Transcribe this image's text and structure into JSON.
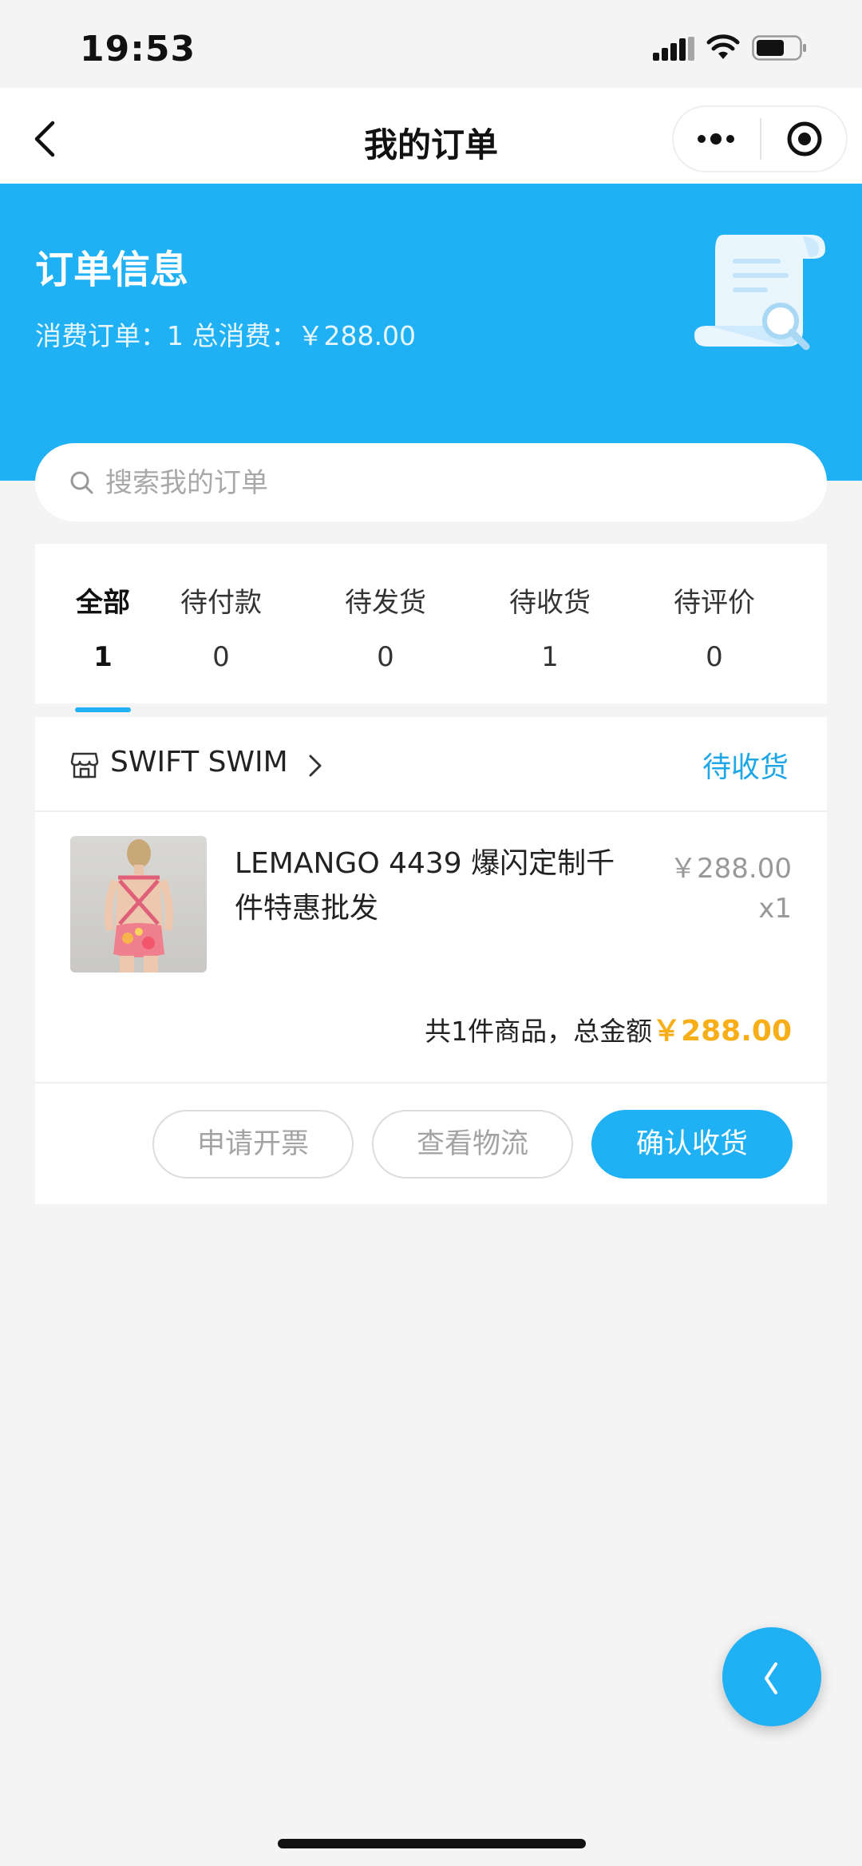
{
  "status_bar": {
    "time": "19:53"
  },
  "nav": {
    "title": "我的订单"
  },
  "header": {
    "title": "订单信息",
    "summary": "消费订单：1 总消费：￥288.00"
  },
  "search": {
    "placeholder": "搜索我的订单"
  },
  "tabs": [
    {
      "label": "全部",
      "count": "1",
      "active": true
    },
    {
      "label": "待付款",
      "count": "0"
    },
    {
      "label": "待发货",
      "count": "0"
    },
    {
      "label": "待收货",
      "count": "1"
    },
    {
      "label": "待评价",
      "count": "0"
    }
  ],
  "order": {
    "store_name": "SWIFT SWIM",
    "status": "待收货",
    "product_name": "LEMANGO 4439 爆闪定制千件特惠批发",
    "price": "￥288.00",
    "quantity": "x1",
    "total_label": "共1件商品，总金额",
    "total_amount": "￥288.00",
    "buttons": {
      "invoice": "申请开票",
      "logistics": "查看物流",
      "confirm": "确认收货"
    }
  },
  "colors": {
    "brand_blue": "#1fb1f3",
    "status_blue": "#1fa6e6",
    "price_orange": "#f7ae18",
    "background": "#f4f4f5"
  },
  "icons": [
    "signal-icon",
    "wifi-icon",
    "battery-icon",
    "back-icon",
    "more-icon",
    "target-icon",
    "scroll-document-icon",
    "search-icon",
    "store-icon",
    "chevron-right-icon",
    "chevron-left-icon"
  ]
}
